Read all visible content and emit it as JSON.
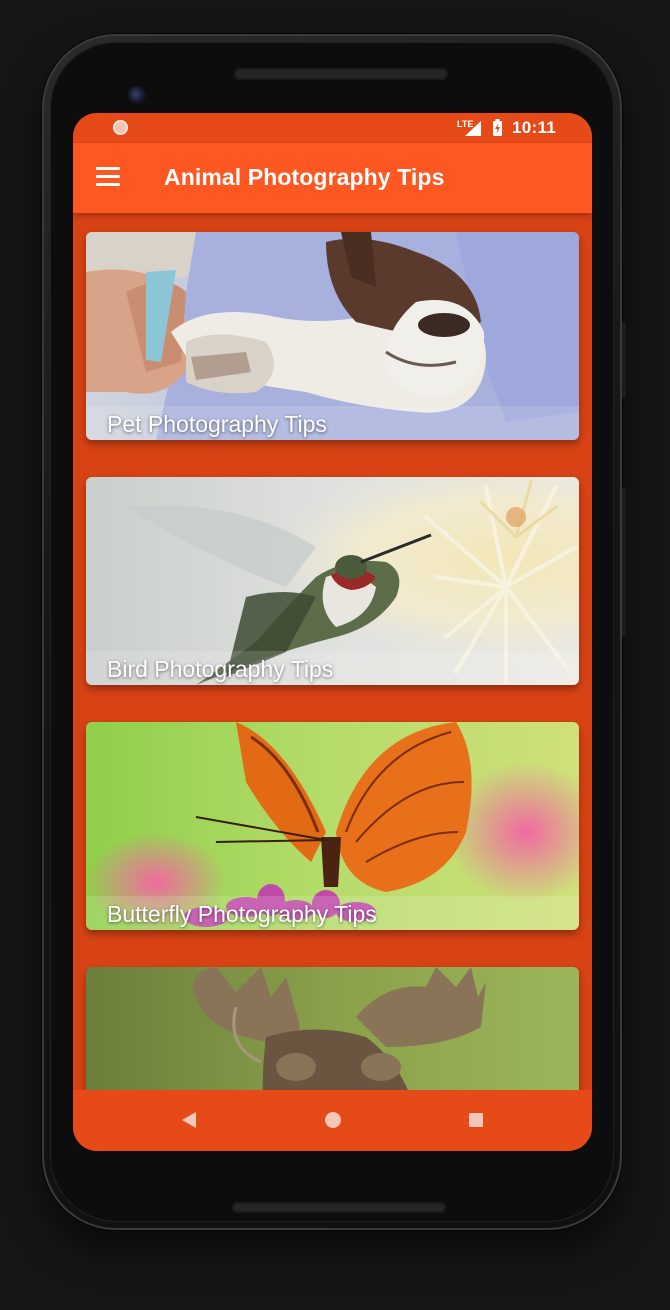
{
  "status_bar": {
    "network": "LTE",
    "time": "10:11",
    "icons": [
      "notification-dot-icon",
      "signal-icon",
      "battery-charging-icon"
    ]
  },
  "app_bar": {
    "title": "Animal Photography Tips",
    "menu_icon": "hamburger-menu-icon"
  },
  "cards": [
    {
      "label": "Pet Photography Tips",
      "image": "sleeping-dog-photo"
    },
    {
      "label": "Bird Photography Tips",
      "image": "hummingbird-photo"
    },
    {
      "label": "Butterfly Photography Tips",
      "image": "orange-butterfly-photo"
    },
    {
      "label": "",
      "image": "moose-photo"
    }
  ],
  "nav_bar": {
    "icons": [
      "back-triangle-icon",
      "home-circle-icon",
      "recent-apps-square-icon"
    ]
  },
  "colors": {
    "status_bar": "#e64a19",
    "app_bar": "#ff5722",
    "background": "#d84315",
    "nav_bar": "#e64a19"
  }
}
